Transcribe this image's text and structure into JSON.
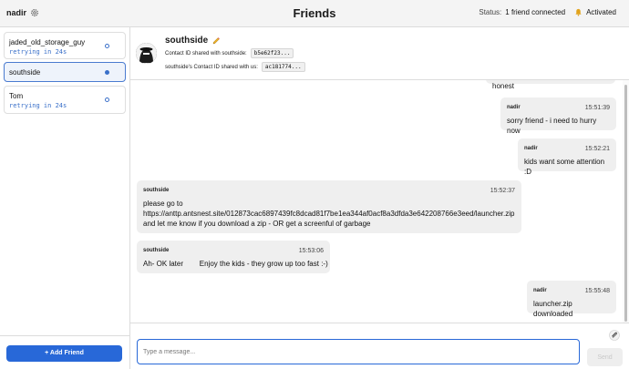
{
  "topbar": {
    "username": "nadir",
    "title": "Friends",
    "status_label": "Status:",
    "status_value": "1 friend connected",
    "activation": "Activated"
  },
  "sidebar": {
    "friends": [
      {
        "name": "jaded_old_storage_guy",
        "sub": "retrying in 24s",
        "active": false
      },
      {
        "name": "southside",
        "sub": "",
        "active": true
      },
      {
        "name": "Tom",
        "sub": "retrying in 24s",
        "active": false
      }
    ],
    "add_friend_label": "+ Add Friend"
  },
  "contact": {
    "name": "southside",
    "shared_with_label": "Contact ID shared with southside:",
    "shared_with_code": "b5e62f23...",
    "shared_with_us_label": "southside's Contact ID shared with us:",
    "shared_with_us_code": "ac181774..."
  },
  "messages": [
    {
      "sender": "",
      "time": "",
      "body": "and not super difficult if we're honest"
    },
    {
      "sender": "nadir",
      "time": "15:51:39",
      "body": "sorry friend - i need to hurry now"
    },
    {
      "sender": "nadir",
      "time": "15:52:21",
      "body": "kids want some attention :D"
    },
    {
      "sender": "southside",
      "time": "15:52:37",
      "body_lines": [
        "please go to",
        "https://anttp.antsnest.site/012873cac6897439fc8dcad81f7be1ea344af0acf8a3dfda3e642208766e3eed/launcher.zip",
        "and let me know if you download a zip  - OR get a screenful of garbage"
      ]
    },
    {
      "sender": "southside",
      "time": "15:53:06",
      "body": "Ah- OK later        Enjoy the kids - they grow up too fast :-)"
    },
    {
      "sender": "nadir",
      "time": "15:55:48",
      "body": "launcher.zip downloaded"
    }
  ],
  "composer": {
    "placeholder": "Type a message...",
    "send_label": "Send"
  },
  "colors": {
    "accent": "#2868d8",
    "bubble": "#efefef",
    "active_friend_bg": "#eef3fb"
  }
}
